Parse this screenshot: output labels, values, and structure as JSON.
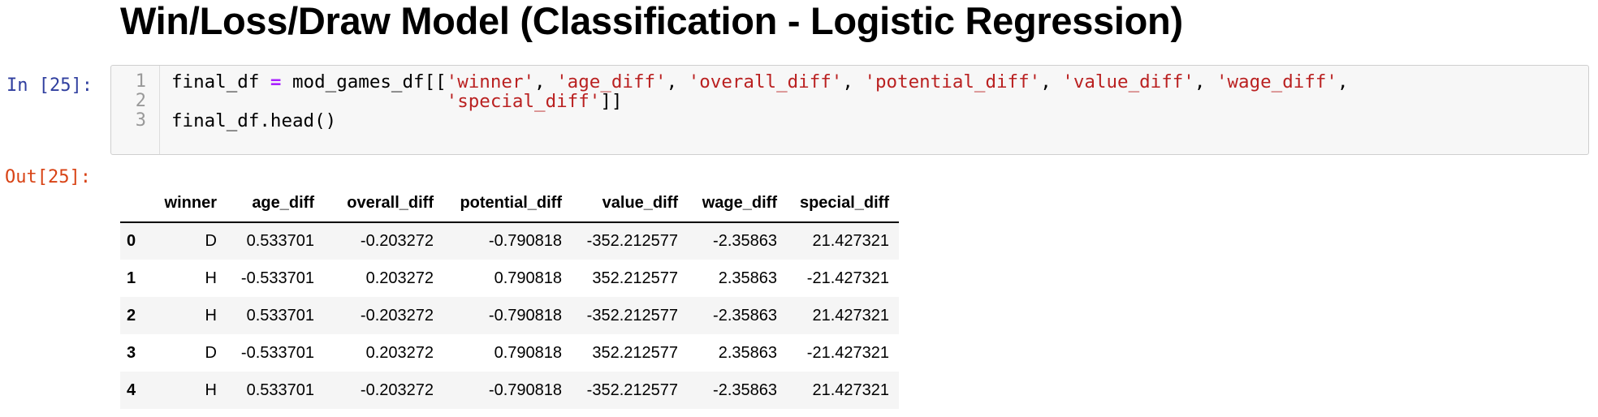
{
  "heading": "Win/Loss/Draw Model (Classification - Logistic Regression)",
  "input_prompt": "In [25]:",
  "output_prompt": "Out[25]:",
  "code": {
    "line_numbers": [
      "1",
      "2",
      "3"
    ],
    "line1": {
      "p1": "final_df ",
      "op": "=",
      "p2": " mod_games_df[[",
      "s1": "'winner'",
      "c1": ", ",
      "s2": "'age_diff'",
      "c2": ", ",
      "s3": "'overall_diff'",
      "c3": ", ",
      "s4": "'potential_diff'",
      "c4": ", ",
      "s5": "'value_diff'",
      "c5": ", ",
      "s6": "'wage_diff'",
      "c6": ","
    },
    "line2": {
      "indent": "                         ",
      "s1": "'special_diff'",
      "end": "]]"
    },
    "line3": "final_df.head()"
  },
  "table": {
    "columns": [
      "",
      "winner",
      "age_diff",
      "overall_diff",
      "potential_diff",
      "value_diff",
      "wage_diff",
      "special_diff"
    ],
    "rows": [
      [
        "0",
        "D",
        "0.533701",
        "-0.203272",
        "-0.790818",
        "-352.212577",
        "-2.35863",
        "21.427321"
      ],
      [
        "1",
        "H",
        "-0.533701",
        "0.203272",
        "0.790818",
        "352.212577",
        "2.35863",
        "-21.427321"
      ],
      [
        "2",
        "H",
        "0.533701",
        "-0.203272",
        "-0.790818",
        "-352.212577",
        "-2.35863",
        "21.427321"
      ],
      [
        "3",
        "D",
        "-0.533701",
        "0.203272",
        "0.790818",
        "352.212577",
        "2.35863",
        "-21.427321"
      ],
      [
        "4",
        "H",
        "0.533701",
        "-0.203272",
        "-0.790818",
        "-352.212577",
        "-2.35863",
        "21.427321"
      ]
    ]
  },
  "colors": {
    "input_prompt": "#303f9f",
    "output_prompt": "#d84315",
    "string": "#ba2121",
    "operator": "#aa22ff"
  }
}
